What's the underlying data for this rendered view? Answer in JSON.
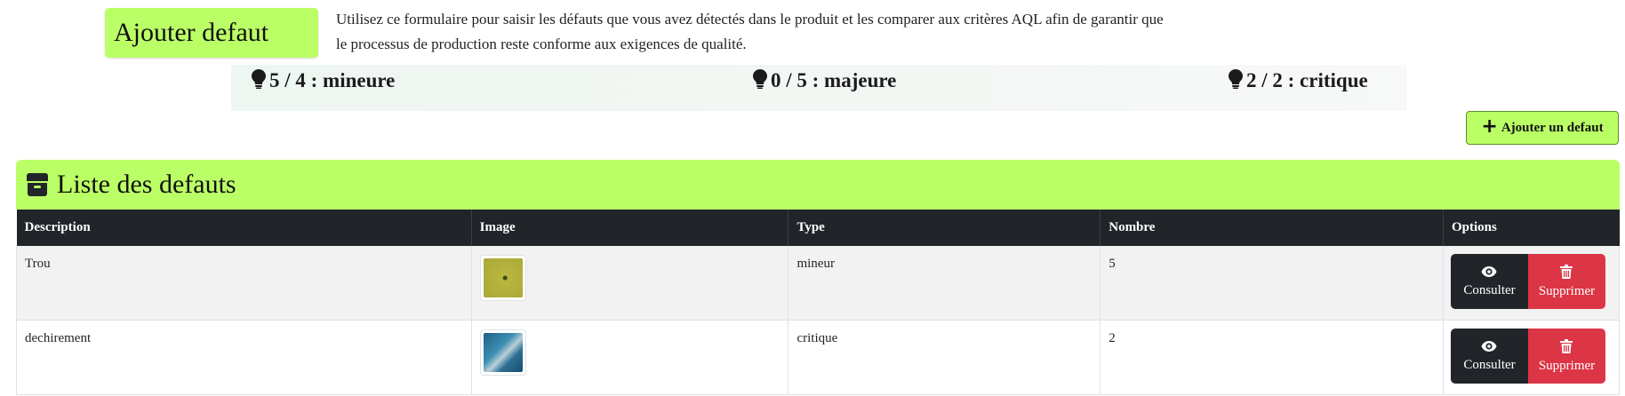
{
  "header": {
    "title": "Ajouter defaut",
    "intro_line1": "Utilisez ce formulaire pour saisir les défauts que vous avez détectés dans le produit et les comparer aux critères AQL afin de garantir que",
    "intro_line2": "le processus de production reste conforme aux exigences de qualité."
  },
  "stats": [
    {
      "label": "5 / 4 : mineure",
      "icon": "lightbulb-icon"
    },
    {
      "label": "0 / 5 : majeure",
      "icon": "lightbulb-icon"
    },
    {
      "label": "2 / 2 : critique",
      "icon": "lightbulb-icon"
    }
  ],
  "add_button": {
    "label": "Ajouter un defaut",
    "icon": "plus-icon"
  },
  "list": {
    "title": "Liste des defauts",
    "icon": "box-icon",
    "columns": [
      "Description",
      "Image",
      "Type",
      "Nombre",
      "Options"
    ],
    "rows": [
      {
        "description": "Trou",
        "type": "mineur",
        "count": "5",
        "image": "hole-thumbnail"
      },
      {
        "description": "dechirement",
        "type": "critique",
        "count": "2",
        "image": "tear-thumbnail"
      }
    ],
    "consult_label": "Consulter",
    "delete_label": "Supprimer"
  },
  "colors": {
    "accent_green": "#bbff66",
    "dark": "#212529",
    "danger": "#dc3545"
  }
}
